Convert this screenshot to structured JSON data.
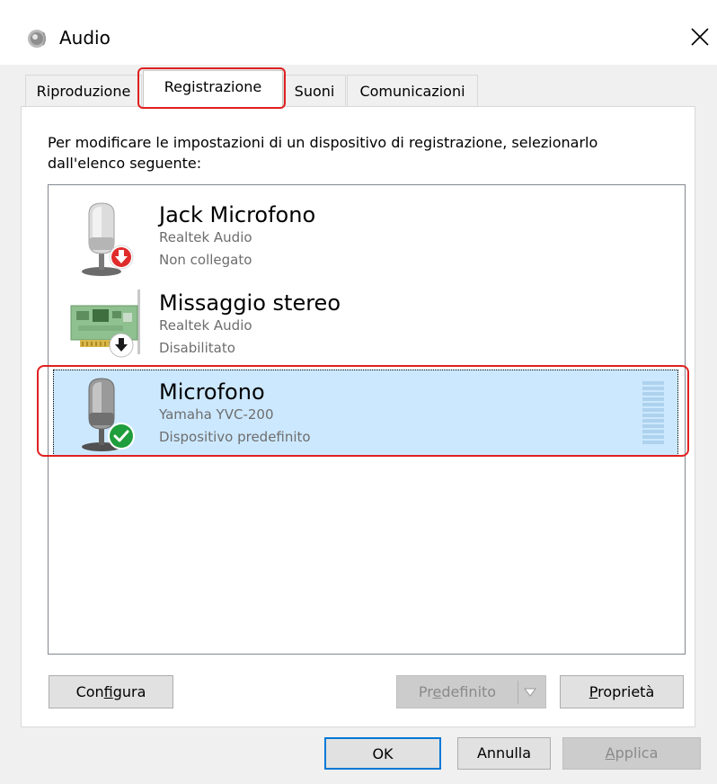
{
  "window": {
    "title": "Audio",
    "icon": "speaker-icon",
    "close_symbol": "✕"
  },
  "tabs": [
    {
      "label": "Riproduzione",
      "selected": false
    },
    {
      "label": "Registrazione",
      "selected": true,
      "highlighted": true
    },
    {
      "label": "Suoni",
      "selected": false
    },
    {
      "label": "Comunicazioni",
      "selected": false
    }
  ],
  "instruction": "Per modificare le impostazioni di un dispositivo di registrazione, selezionarlo dall'elenco seguente:",
  "devices": [
    {
      "name": "Jack Microfono",
      "driver": "Realtek Audio",
      "status": "Non collegato",
      "icon": "microphone-icon",
      "badge": "red-down-arrow-icon"
    },
    {
      "name": "Missaggio stereo",
      "driver": "Realtek Audio",
      "status": "Disabilitato",
      "icon": "sound-card-icon",
      "badge": "black-down-arrow-icon"
    },
    {
      "name": "Microfono",
      "driver": "Yamaha YVC-200",
      "status": "Dispositivo predefinito",
      "icon": "microphone-icon",
      "badge": "green-check-icon",
      "selected": true,
      "highlighted": true
    }
  ],
  "buttons": {
    "configura": {
      "pre": "Con",
      "ul": "f",
      "post": "igura"
    },
    "predefinito": {
      "pre": "Pr",
      "ul": "e",
      "post": "definito",
      "enabled": false
    },
    "proprieta": {
      "pre": "",
      "ul": "P",
      "post": "roprietà"
    },
    "ok": "OK",
    "annulla": "Annulla",
    "applica": {
      "pre": "",
      "ul": "A",
      "post": "pplica",
      "enabled": false
    }
  },
  "colors": {
    "selection_bg": "#cce8ff",
    "highlight_red": "#e02020",
    "ok_border": "#0078d7",
    "level_meter": "#aed2ee"
  }
}
